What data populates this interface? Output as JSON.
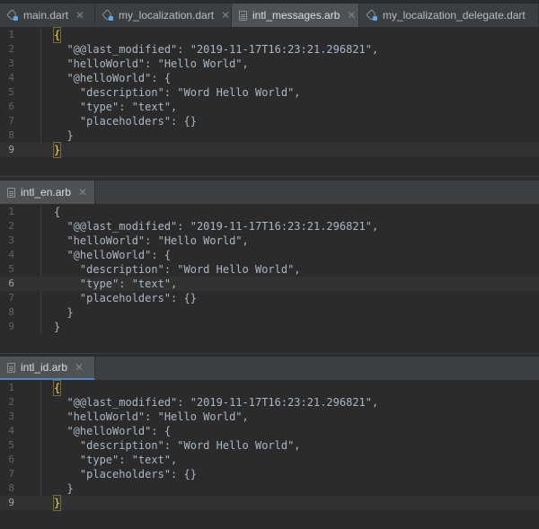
{
  "top_tabs": [
    {
      "label": "main.dart",
      "icon": "dart-icon",
      "active": false
    },
    {
      "label": "my_localization.dart",
      "icon": "dart-icon",
      "active": false
    },
    {
      "label": "intl_messages.arb",
      "icon": "file-icon",
      "active": true
    },
    {
      "label": "my_localization_delegate.dart",
      "icon": "dart-icon",
      "active": false
    }
  ],
  "close_glyph": "✕",
  "panes": [
    {
      "tab_label": "intl_en.arb",
      "current_line": 6,
      "lines": [
        "{",
        "  \"@@last_modified\": \"2019-11-17T16:23:21.296821\",",
        "  \"helloWorld\": \"Hello World\",",
        "  \"@helloWorld\": {",
        "    \"description\": \"Word Hello World\",",
        "    \"type\": \"text\",",
        "    \"placeholders\": {}",
        "  }",
        "}"
      ]
    },
    {
      "tab_label": "intl_id.arb",
      "current_line": 9,
      "lines": [
        "{",
        "  \"@@last_modified\": \"2019-11-17T16:23:21.296821\",",
        "  \"helloWorld\": \"Hello World\",",
        "  \"@helloWorld\": {",
        "    \"description\": \"Word Hello World\",",
        "    \"type\": \"text\",",
        "    \"placeholders\": {}",
        "  }",
        "}"
      ]
    }
  ],
  "main_editor": {
    "current_line": 9,
    "lines": [
      "{",
      "  \"@@last_modified\": \"2019-11-17T16:23:21.296821\",",
      "  \"helloWorld\": \"Hello World\",",
      "  \"@helloWorld\": {",
      "    \"description\": \"Word Hello World\",",
      "    \"type\": \"text\",",
      "    \"placeholders\": {}",
      "  }",
      "}"
    ]
  },
  "line_numbers": [
    "1",
    "2",
    "3",
    "4",
    "5",
    "6",
    "7",
    "8",
    "9"
  ],
  "colors": {
    "background": "#2b2b2b",
    "tabbar": "#3c3f41",
    "matched_brace": "#fdd835",
    "accent": "#4a88c7"
  }
}
